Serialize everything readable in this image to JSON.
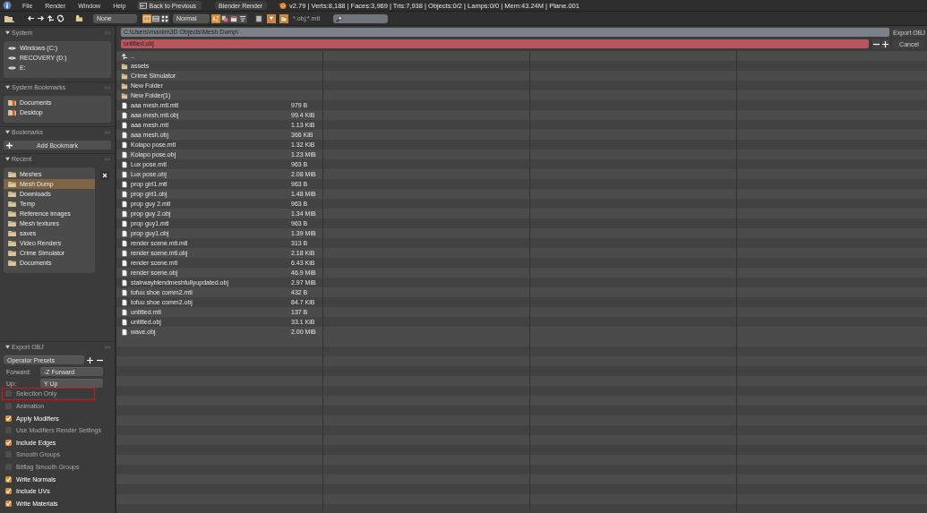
{
  "menu_bar": {
    "menus": [
      "File",
      "Render",
      "Window",
      "Help"
    ],
    "back_button": "Back to Previous",
    "engine": "Blender Render",
    "stats": "v2.79 | Verts:8,188 | Faces:3,969 | Tris:7,938 | Objects:0/2 | Lamps:0/0 | Mem:43.24M | Plane.001"
  },
  "toolbar": {
    "recursion": "None",
    "display_size": "Normal",
    "filter_glob": "*.obj;*.mtl",
    "display_modes": [
      {
        "kind": "short",
        "selected": true
      },
      {
        "kind": "long",
        "selected": false
      },
      {
        "kind": "thumbnails",
        "selected": false
      }
    ],
    "sort_modes": [
      {
        "kind": "alpha",
        "selected": true
      },
      {
        "kind": "extension",
        "selected": false
      },
      {
        "kind": "time",
        "selected": false
      },
      {
        "kind": "size",
        "selected": false
      }
    ],
    "filters": [
      {
        "kind": "hidden",
        "on": false
      },
      {
        "kind": "funnel",
        "on": true
      },
      {
        "kind": "folder",
        "on": true
      }
    ]
  },
  "path": "C:\\Users\\maxim\\3D Objects\\Mesh Dump\\",
  "filename": "untitled.obj",
  "file_exists": true,
  "buttons": [
    "Export OBJ",
    "Cancel"
  ],
  "sidebar": {
    "system": {
      "title": "System",
      "expanded": true,
      "items": [
        "Windows (C:)",
        "RECOVERY (D:)",
        "E:"
      ]
    },
    "system_bookmarks": {
      "title": "System Bookmarks",
      "expanded": true,
      "items": [
        "Documents",
        "Desktop"
      ]
    },
    "bookmarks": {
      "title": "Bookmarks",
      "expanded": true,
      "add_button": "Add Bookmark"
    },
    "recent": {
      "title": "Recent",
      "expanded": true,
      "items": [
        {
          "name": "Meshes",
          "selected": false
        },
        {
          "name": "Mesh Dump",
          "selected": true
        },
        {
          "name": "Downloads",
          "selected": false
        },
        {
          "name": "Temp",
          "selected": false
        },
        {
          "name": "Reference images",
          "selected": false
        },
        {
          "name": "Mesh textures",
          "selected": false
        },
        {
          "name": "saves",
          "selected": false
        },
        {
          "name": "Video Renders",
          "selected": false
        },
        {
          "name": "Crime Simulator",
          "selected": false
        },
        {
          "name": "Documents",
          "selected": false
        }
      ]
    },
    "export": {
      "title": "Export OBJ",
      "expanded": true,
      "presets": "Operator Presets",
      "forward_label": "Forward:",
      "forward": "-Z Forward",
      "up_label": "Up:",
      "up": "Y Up",
      "options": [
        {
          "label": "Selection Only",
          "checked": false,
          "highlighted": true
        },
        {
          "label": "Animation",
          "checked": false,
          "highlighted": false
        },
        {
          "label": "Apply Modifiers",
          "checked": true,
          "highlighted": false
        },
        {
          "label": "Use Modifiers Render Settings",
          "checked": false,
          "highlighted": false
        },
        {
          "label": "Include Edges",
          "checked": true,
          "highlighted": false
        },
        {
          "label": "Smooth Groups",
          "checked": false,
          "highlighted": false
        },
        {
          "label": "Bitflag Smooth Groups",
          "checked": false,
          "highlighted": false
        },
        {
          "label": "Write Normals",
          "checked": true,
          "highlighted": false
        },
        {
          "label": "Include UVs",
          "checked": true,
          "highlighted": false
        },
        {
          "label": "Write Materials",
          "checked": true,
          "highlighted": false
        }
      ]
    }
  },
  "files": [
    {
      "kind": "parent",
      "name": ".."
    },
    {
      "kind": "folder",
      "name": "assets"
    },
    {
      "kind": "folder",
      "name": "Crime Simulator"
    },
    {
      "kind": "folder",
      "name": "New Folder"
    },
    {
      "kind": "folder",
      "name": "New Folder(1)"
    },
    {
      "kind": "file",
      "name": "aaa mesh.mtl.mtl",
      "size": "979 B"
    },
    {
      "kind": "file",
      "name": "aaa mesh.mtl.obj",
      "size": "99.4 KiB"
    },
    {
      "kind": "file",
      "name": "aaa mesh.mtl",
      "size": "1.13 KiB"
    },
    {
      "kind": "file",
      "name": "aaa mesh.obj",
      "size": "366 KiB"
    },
    {
      "kind": "file",
      "name": "Kolapo pose.mtl",
      "size": "1.32 KiB"
    },
    {
      "kind": "file",
      "name": "Kolapo pose.obj",
      "size": "1.23 MiB"
    },
    {
      "kind": "file",
      "name": "Lux pose.mtl",
      "size": "963 B"
    },
    {
      "kind": "file",
      "name": "Lux pose.obj",
      "size": "2.08 MiB"
    },
    {
      "kind": "file",
      "name": "prop girl1.mtl",
      "size": "963 B"
    },
    {
      "kind": "file",
      "name": "prop girl1.obj",
      "size": "1.48 MiB"
    },
    {
      "kind": "file",
      "name": "prop guy 2.mtl",
      "size": "963 B"
    },
    {
      "kind": "file",
      "name": "prop guy 2.obj",
      "size": "1.34 MiB"
    },
    {
      "kind": "file",
      "name": "prop guy1.mtl",
      "size": "963 B"
    },
    {
      "kind": "file",
      "name": "prop guy1.obj",
      "size": "1.39 MiB"
    },
    {
      "kind": "file",
      "name": "render scene.mtl.mtl",
      "size": "313 B"
    },
    {
      "kind": "file",
      "name": "render scene.mtl.obj",
      "size": "2.18 KiB"
    },
    {
      "kind": "file",
      "name": "render scene.mtl",
      "size": "6.43 KiB"
    },
    {
      "kind": "file",
      "name": "render scene.obj",
      "size": "46.9 MiB"
    },
    {
      "kind": "file",
      "name": "stairwayblendmeshfullyupdated.obj",
      "size": "2.97 MiB"
    },
    {
      "kind": "file",
      "name": "tofuu shoe comm2.mtl",
      "size": "432 B"
    },
    {
      "kind": "file",
      "name": "tofuu shoe comm2.obj",
      "size": "84.7 KiB"
    },
    {
      "kind": "file",
      "name": "untitled.mtl",
      "size": "137 B"
    },
    {
      "kind": "file",
      "name": "untitled.obj",
      "size": "33.1 KiB"
    },
    {
      "kind": "file",
      "name": "wave.obj",
      "size": "2.00 MiB"
    }
  ]
}
